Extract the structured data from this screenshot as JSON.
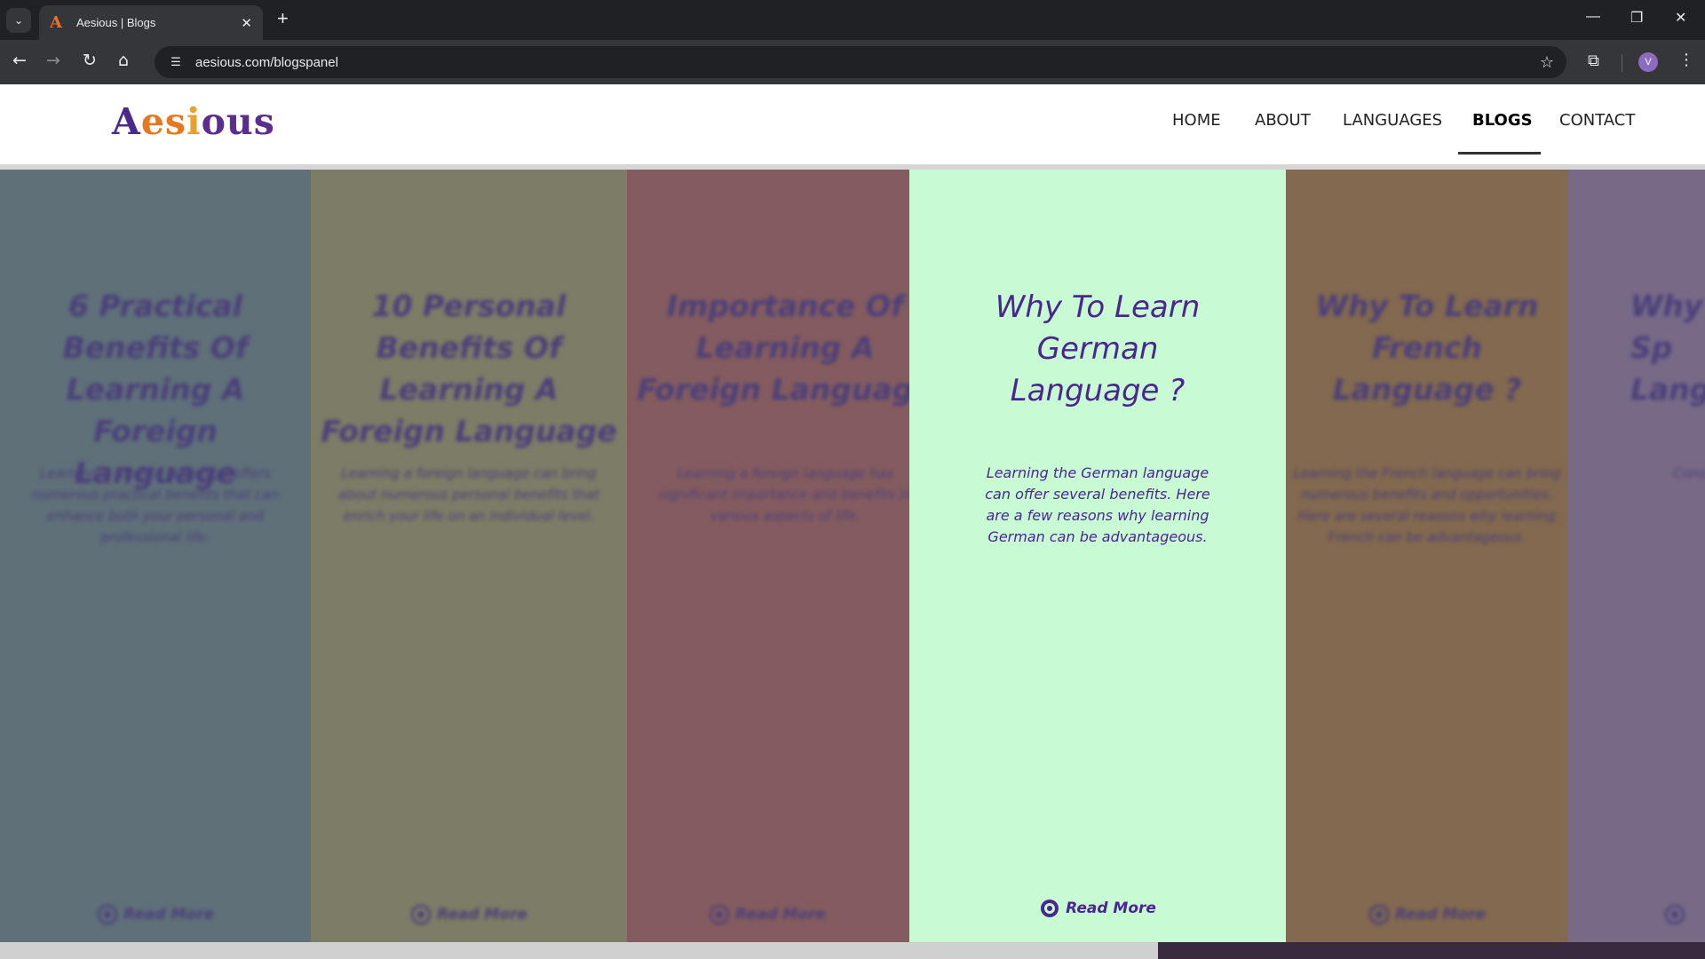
{
  "browser": {
    "tab_title": "Aesious | Blogs",
    "tab_favicon": "A",
    "url": "aesious.com/blogspanel",
    "profile_initial": "V"
  },
  "site": {
    "logo_letters": [
      "A",
      "es",
      "i",
      "ous"
    ],
    "nav": [
      "HOME",
      "ABOUT",
      "LANGUAGES",
      "BLOGS",
      "CONTACT"
    ],
    "active_nav": "BLOGS"
  },
  "panels": [
    {
      "title": "6 Practical Benefits Of Learning A Foreign Language",
      "desc": "Learning a foreign language offers numerous practical benefits that can enhance both your personal and professional life.",
      "read_more": "Read More",
      "bg": "#5f7079",
      "active": false
    },
    {
      "title": "10 Personal Benefits Of Learning A Foreign Language",
      "desc": "Learning a foreign language can bring about numerous personal benefits that enrich your life on an individual level.",
      "read_more": "Read More",
      "bg": "#7d7c67",
      "active": false
    },
    {
      "title": "Importance Of Learning A Foreign Language",
      "desc": "Learning a foreign language has significant importance and benefits in various aspects of life.",
      "read_more": "Read More",
      "bg": "#845c5f",
      "active": false
    },
    {
      "title": "Why To Learn German Language ?",
      "desc": "Learning the German language can offer several benefits. Here are a few reasons why learning German can be advantageous.",
      "read_more": "Read More",
      "bg": "#c8fbd3",
      "active": true
    },
    {
      "title": "Why To Learn French Language ?",
      "desc": "Learning the French language can bring numerous benefits and opportunities. Here are several reasons why learning French can be advantageous.",
      "read_more": "Read More",
      "bg": "#82694f",
      "active": false
    },
    {
      "title": "Why T Sp Lang",
      "desc": "Cons",
      "read_more": "",
      "bg": "#776a86",
      "active": false
    }
  ],
  "colors": {
    "accent_purple": "#4a2790",
    "logo_orange": "#e87722"
  }
}
